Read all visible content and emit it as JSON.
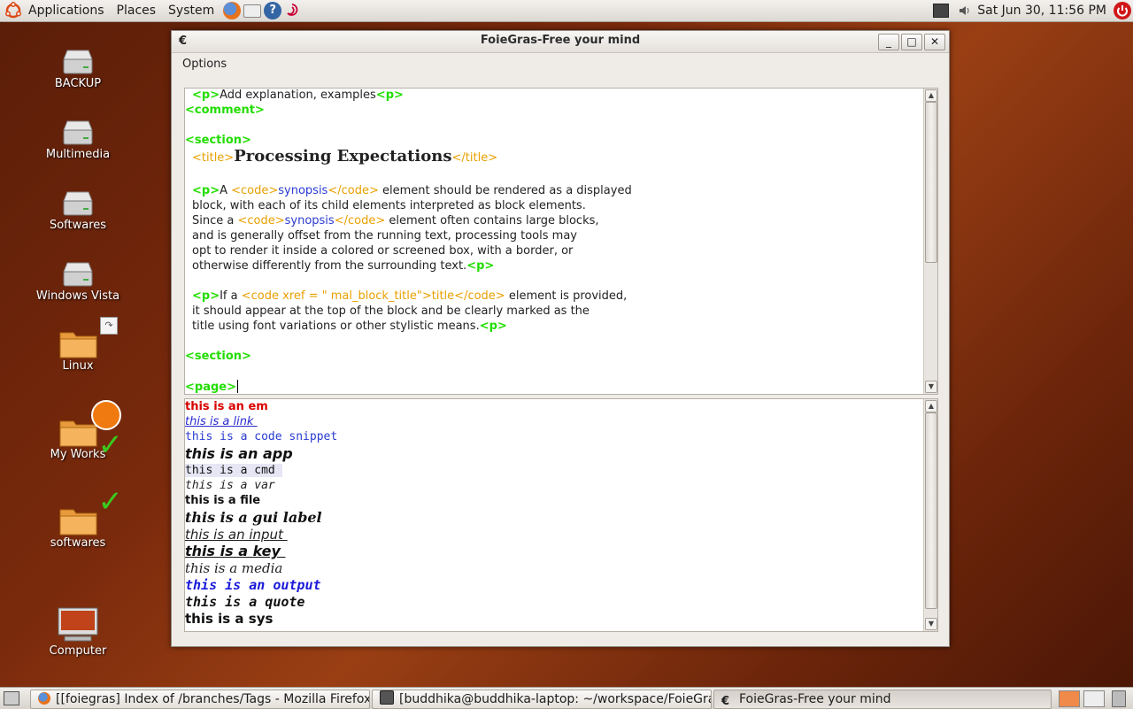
{
  "top_panel": {
    "menus": [
      "Applications",
      "Places",
      "System"
    ],
    "clock": "Sat Jun 30, 11:56 PM"
  },
  "desktop": {
    "icons": [
      {
        "label": "BACKUP",
        "kind": "drive-icon"
      },
      {
        "label": "Multimedia",
        "kind": "drive-icon"
      },
      {
        "label": "Softwares",
        "kind": "drive-icon"
      },
      {
        "label": "Windows Vista",
        "kind": "drive-icon"
      },
      {
        "label": "Linux",
        "kind": "folder-icon"
      },
      {
        "label": "My Works",
        "kind": "folder-icon"
      },
      {
        "label": "softwares",
        "kind": "folder-icon"
      },
      {
        "label": "Computer",
        "kind": "computer-icon"
      }
    ]
  },
  "window": {
    "title": "FoieGras-Free your mind",
    "menu_options": "Options",
    "editor": {
      "l1a": "<p>",
      "l1b": "Add explanation, examples",
      "l1c": "<p>",
      "l2": "<comment>",
      "l3": "<section>",
      "l4a": "<title>",
      "l4b": "Processing Expectations",
      "l4c": "</title>",
      "p1a": "<p>",
      "p1b": "A ",
      "p1c": "<code>",
      "p1d": "synopsis",
      "p1e": "</code>",
      "p1f": " element should be rendered as a displayed",
      "p1g": "block, with each of its child elements interpreted as block elements.",
      "p1h": "Since a ",
      "p1i": "<code>",
      "p1j": "synopsis",
      "p1k": "</code>",
      "p1l": " element often contains large blocks,",
      "p1m": "and is generally offset from the running text, processing tools may",
      "p1n": "opt to render it inside a colored or screened box, with a border, or",
      "p1o": "otherwise differently from the surrounding text.",
      "p1p": "<p>",
      "p2a": "<p>",
      "p2b": "If a ",
      "p2c": "<code xref = \" mal_block_title\">",
      "p2d": "title",
      "p2e": "</code>",
      "p2f": " element is provided,",
      "p2g": "it should appear at the top of the block and be clearly marked as the",
      "p2h": "title using font variations or other stylistic means.",
      "p2i": "<p>",
      "l5": "<section>",
      "l6": "<page>"
    },
    "samples": {
      "em": "this is an em",
      "link": "this is a link ",
      "code": "this is a code snippet",
      "app": "this is an app",
      "cmd": "this is a cmd ",
      "var": "this is a var",
      "file": "this is a file",
      "gui": "this is a gui label",
      "input": "this is an input ",
      "key": "this is a key ",
      "media": "this is a media",
      "output": "this is an output",
      "quote": "this is a quote",
      "sys": "this is a sys"
    }
  },
  "taskbar": {
    "tasks": [
      "[[foiegras] Index of /branches/Tags - Mozilla Firefox]",
      "[buddhika@buddhika-laptop: ~/workspace/FoieGras...",
      "FoieGras-Free your mind"
    ]
  }
}
